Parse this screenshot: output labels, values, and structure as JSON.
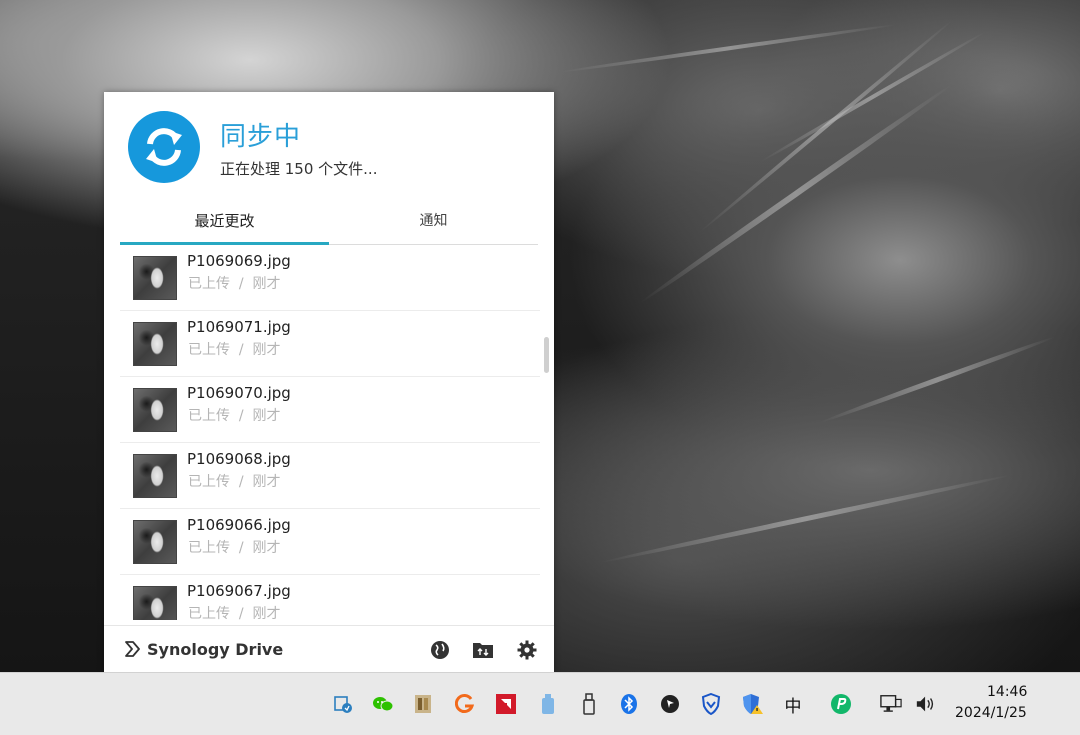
{
  "panel": {
    "status_title": "同步中",
    "status_subtitle": "正在处理 150 个文件...",
    "tabs": [
      {
        "label": "最近更改",
        "active": true
      },
      {
        "label": "通知",
        "active": false
      }
    ],
    "files": [
      {
        "name": "P1069069.jpg",
        "status": "已上传",
        "separator": "/",
        "time": "刚才"
      },
      {
        "name": "P1069071.jpg",
        "status": "已上传",
        "separator": "/",
        "time": "刚才"
      },
      {
        "name": "P1069070.jpg",
        "status": "已上传",
        "separator": "/",
        "time": "刚才"
      },
      {
        "name": "P1069068.jpg",
        "status": "已上传",
        "separator": "/",
        "time": "刚才"
      },
      {
        "name": "P1069066.jpg",
        "status": "已上传",
        "separator": "/",
        "time": "刚才"
      },
      {
        "name": "P1069067.jpg",
        "status": "已上传",
        "separator": "/",
        "time": "刚才"
      }
    ],
    "footer": {
      "brand": "Synology Drive",
      "buttons": [
        "globe-icon",
        "folder-sync-icon",
        "gear-icon"
      ]
    }
  },
  "colors": {
    "accent_blue": "#1698dc",
    "title_blue": "#2a9fd8",
    "tab_underline": "#27a8c2",
    "meta_gray": "#b5b5b5"
  },
  "taskbar": {
    "tray_icons": [
      "network-sync-icon",
      "wechat-icon",
      "app-icon",
      "g-app-icon",
      "amd-icon",
      "usb-storage-icon",
      "usb-drive-icon",
      "bluetooth-icon",
      "cursor-app-icon",
      "shield-icon",
      "security-warning-icon",
      "ime-icon",
      "vpn-icon",
      "display-network-icon",
      "speaker-icon"
    ],
    "ime_label": "中",
    "clock_time": "14:46",
    "clock_date": "2024/1/25"
  }
}
